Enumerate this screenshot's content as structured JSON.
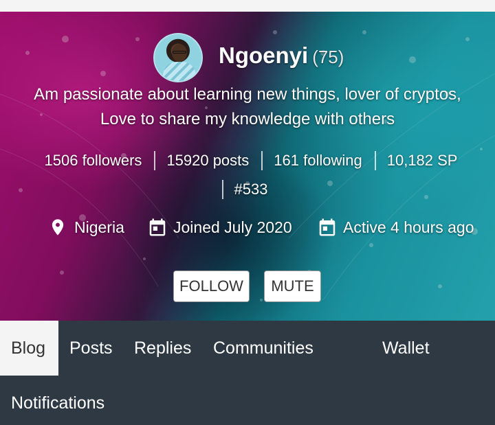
{
  "profile": {
    "name": "Ngoenyi",
    "reputation": "(75)",
    "about": "Am passionate about learning new things, lover of cryptos, Love to share my knowledge with others",
    "stats": {
      "followers": "1506 followers",
      "posts": "15920 posts",
      "following": "161 following",
      "sp": "10,182 SP",
      "rank": "#533"
    },
    "meta": {
      "location": "Nigeria",
      "joined": "Joined July 2020",
      "active": "Active 4 hours ago"
    }
  },
  "actions": {
    "follow": "FOLLOW",
    "mute": "MUTE"
  },
  "tabs": [
    {
      "label": "Blog"
    },
    {
      "label": "Posts"
    },
    {
      "label": "Replies"
    },
    {
      "label": "Communities"
    },
    {
      "label": "Wallet"
    },
    {
      "label": "Notifications"
    }
  ],
  "colors": {
    "tab_bar": "#2e3944",
    "active_tab_bg": "#f4f4f4",
    "hero_magenta": "#b3127a",
    "hero_teal": "#1ea2b1"
  },
  "icons": {
    "location": "map-pin-icon",
    "joined": "calendar-icon",
    "active": "calendar-icon"
  }
}
